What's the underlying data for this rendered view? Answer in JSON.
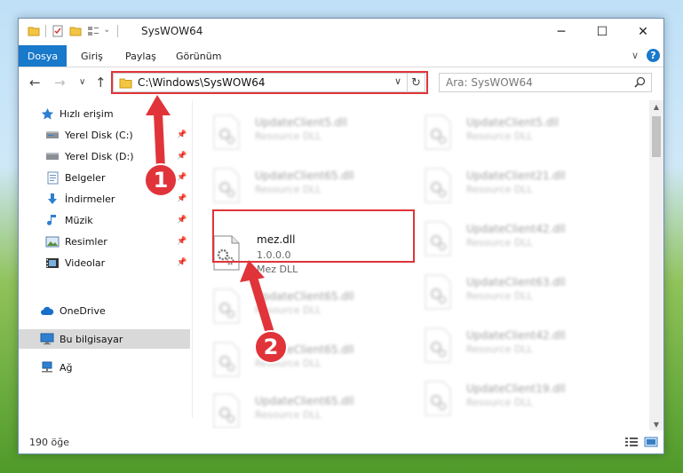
{
  "window": {
    "title": "SysWOW64",
    "controls": {
      "minimize": "─",
      "maximize": "☐",
      "close": "✕"
    }
  },
  "ribbon": {
    "tabs": [
      "Dosya",
      "Giriş",
      "Paylaş",
      "Görünüm"
    ],
    "expand_glyph": "∨",
    "help_glyph": "?"
  },
  "address_bar": {
    "path": "C:\\Windows\\SysWOW64",
    "dropdown_glyph": "∨",
    "refresh_glyph": "↻",
    "search_placeholder": "Ara: SysWOW64"
  },
  "nav_glyphs": {
    "back": "←",
    "forward": "→",
    "recent": "∨",
    "up": "↑"
  },
  "nav_pane": {
    "quick_access": "Hızlı erişim",
    "items": [
      {
        "label": "Yerel Disk (C:)",
        "icon": "drive-icon",
        "pinned": true
      },
      {
        "label": "Yerel Disk (D:)",
        "icon": "drive-icon",
        "pinned": true
      },
      {
        "label": "Belgeler",
        "icon": "documents-icon",
        "pinned": true
      },
      {
        "label": "İndirmeler",
        "icon": "downloads-icon",
        "pinned": true
      },
      {
        "label": "Müzik",
        "icon": "music-icon",
        "pinned": true
      },
      {
        "label": "Resimler",
        "icon": "pictures-icon",
        "pinned": true
      },
      {
        "label": "Videolar",
        "icon": "videos-icon",
        "pinned": true
      }
    ],
    "onedrive": "OneDrive",
    "this_pc": "Bu bilgisayar",
    "network": "Ağ",
    "pin_glyph": "📌"
  },
  "files": {
    "left_column": [
      {
        "name": "UpdateClient5.dll",
        "type": "Resource DLL"
      },
      {
        "name": "UpdateClient65.dll",
        "type": "Resource DLL"
      },
      {
        "name": "mez.dll",
        "version": "1.0.0.0",
        "type": "Mez DLL",
        "highlighted": true
      },
      {
        "name": "UpdateClient65.dll",
        "type": "Resource DLL"
      },
      {
        "name": "UpdateClient65.dll",
        "type": "Resource DLL"
      },
      {
        "name": "UpdateClient65.dll",
        "type": "Resource DLL"
      }
    ],
    "right_column": [
      {
        "name": "UpdateClient5.dll",
        "type": "Resource DLL"
      },
      {
        "name": "UpdateClient21.dll",
        "type": "Resource DLL"
      },
      {
        "name": "UpdateClient42.dll",
        "type": "Resource DLL"
      },
      {
        "name": "UpdateClient63.dll",
        "type": "Resource DLL"
      },
      {
        "name": "UpdateClient42.dll",
        "type": "Resource DLL"
      },
      {
        "name": "UpdateClient19.dll",
        "type": "Resource DLL"
      }
    ]
  },
  "status": {
    "item_count": "190 öğe"
  },
  "annotations": [
    {
      "number": "1"
    },
    {
      "number": "2"
    }
  ],
  "colors": {
    "accent": "#1979ca",
    "annotation_red": "#e0343a"
  }
}
